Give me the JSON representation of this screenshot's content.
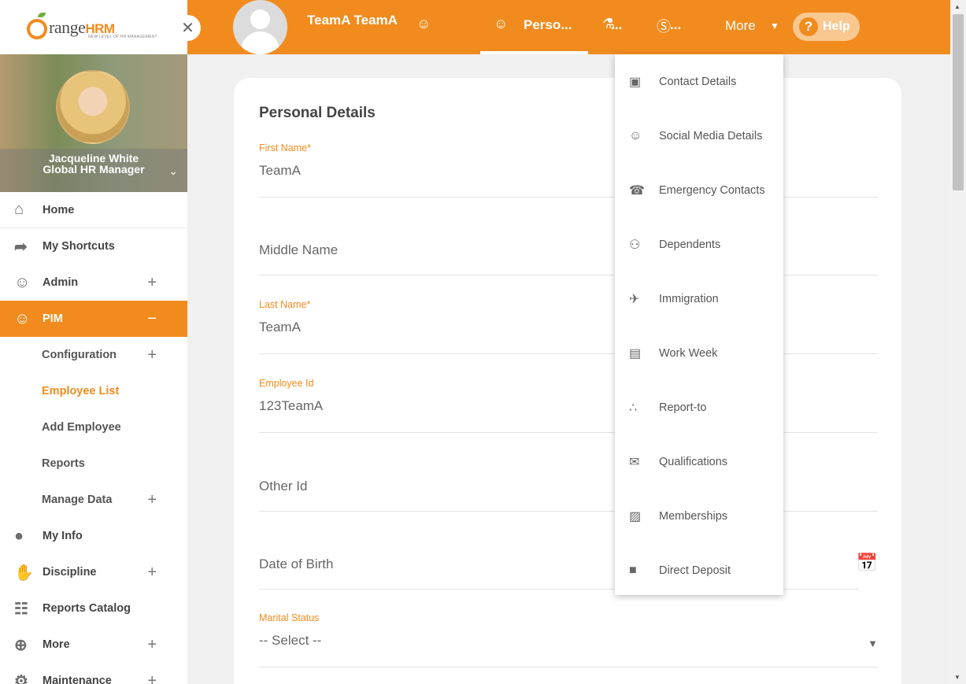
{
  "brand": {
    "logo_text": "range",
    "logo_o": "O",
    "logo_hrm": "HRM",
    "tagline": "NEW LEVEL OF HR MANAGEMENT"
  },
  "profile": {
    "name": "Jacqueline White",
    "role": "Global HR Manager"
  },
  "sidebar": {
    "items": [
      {
        "label": "Home",
        "icon": "home-icon"
      },
      {
        "label": "My Shortcuts",
        "icon": "share-icon"
      },
      {
        "label": "Admin",
        "icon": "admin-icon"
      },
      {
        "label": "PIM",
        "icon": "pim-icon"
      },
      {
        "label": "My Info",
        "icon": "user-circle-icon"
      },
      {
        "label": "Discipline",
        "icon": "discipline-icon"
      },
      {
        "label": "Reports Catalog",
        "icon": "document-icon"
      },
      {
        "label": "More",
        "icon": "plus-circle-icon"
      },
      {
        "label": "Maintenance",
        "icon": "gear-icon"
      }
    ],
    "pim_sub": [
      "Configuration",
      "Employee List",
      "Add Employee",
      "Reports",
      "Manage Data"
    ],
    "plus": "+",
    "minus": "−"
  },
  "topbar": {
    "employee_name": "TeamA TeamA",
    "tab_personal": "Perso...",
    "tab_job": "...",
    "tab_salary": "...",
    "more": "More",
    "help": "Help"
  },
  "form": {
    "title": "Personal Details",
    "first_name_label": "First Name",
    "first_name_value": "TeamA",
    "middle_name_placeholder": "Middle Name",
    "last_name_label": "Last Name",
    "last_name_value": "TeamA",
    "employee_id_label": "Employee Id",
    "employee_id_value": "123TeamA",
    "other_id_placeholder": "Other Id",
    "dob_placeholder": "Date of Birth",
    "marital_status_label": "Marital Status",
    "marital_status_value": "-- Select --",
    "required_mark": "*"
  },
  "more_menu": [
    {
      "label": "Contact Details",
      "icon": "contact-card-icon"
    },
    {
      "label": "Social Media Details",
      "icon": "social-media-icon"
    },
    {
      "label": "Emergency Contacts",
      "icon": "phone-icon"
    },
    {
      "label": "Dependents",
      "icon": "users-icon"
    },
    {
      "label": "Immigration",
      "icon": "plane-icon"
    },
    {
      "label": "Work Week",
      "icon": "calendar-badge-icon"
    },
    {
      "label": "Report-to",
      "icon": "org-chart-icon"
    },
    {
      "label": "Qualifications",
      "icon": "qualification-icon"
    },
    {
      "label": "Memberships",
      "icon": "membership-icon"
    },
    {
      "label": "Direct Deposit",
      "icon": "wallet-icon"
    }
  ],
  "colors": {
    "accent": "#f28b1e",
    "sidebar_bg": "#ffffff",
    "page_bg": "#f0f0f0"
  }
}
